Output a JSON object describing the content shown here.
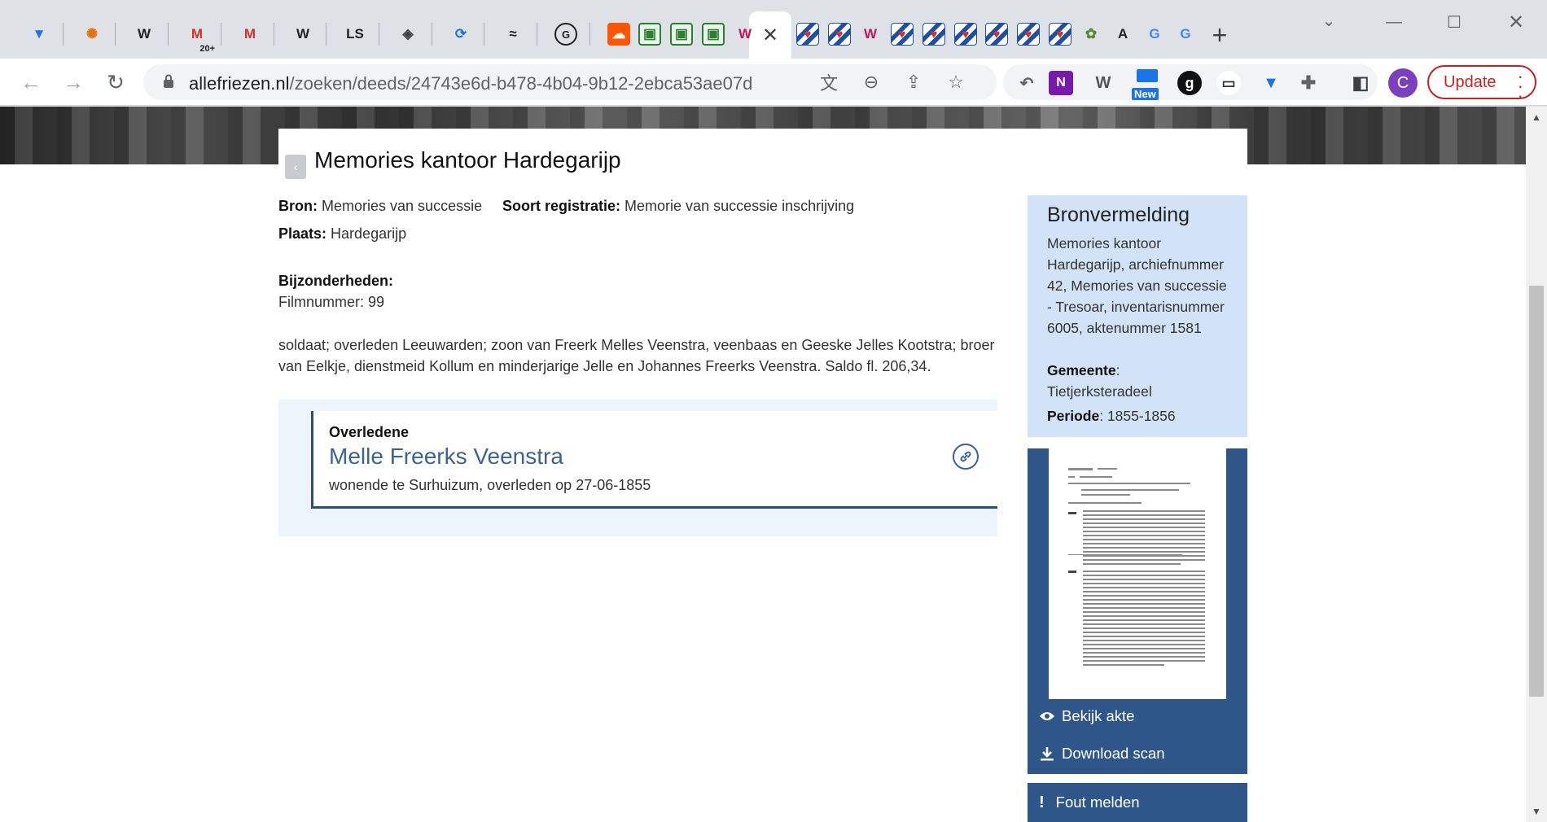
{
  "browser": {
    "active_tab_close": "✕",
    "new_tab": "+",
    "url_domain": "allefriezen.nl",
    "url_path": "/zoeken/deeds/24743e6d-b478-4b04-9b12-2ebca53ae07d",
    "avatar_letter": "C",
    "update_label": "Update",
    "tabs": [
      {
        "text": "",
        "color": "#1a73e8",
        "icon": "heart-shield-icon"
      },
      {
        "text": "✺",
        "color": "#e8710a",
        "icon": "leaf-icon"
      },
      {
        "text": "W",
        "color": "#202124",
        "icon": "wikipedia-icon"
      },
      {
        "text": "M",
        "color": "#d93025",
        "icon": "gmail-icon"
      },
      {
        "text": "M",
        "color": "#d93025",
        "icon": "gmail-icon"
      },
      {
        "text": "W",
        "color": "#202124",
        "icon": "wikipedia-icon"
      },
      {
        "text": "LS",
        "color": "#202124",
        "icon": "ls-icon"
      },
      {
        "text": "◈",
        "color": "#3c4043",
        "icon": "diamond-icon"
      },
      {
        "text": "⟳",
        "color": "#1a73e8",
        "icon": "sync-icon"
      },
      {
        "text": "≈",
        "color": "#202124",
        "icon": "wave-icon"
      },
      {
        "text": "G",
        "color": "#202124",
        "icon": "g-badge-icon"
      },
      {
        "text": "☁",
        "color": "#ff5500",
        "icon": "soundcloud-icon"
      },
      {
        "text": "▣",
        "color": "#2e7d32",
        "icon": "archive-icon"
      },
      {
        "text": "▣",
        "color": "#2e7d32",
        "icon": "archive-icon"
      },
      {
        "text": "▣",
        "color": "#2e7d32",
        "icon": "archive-icon"
      },
      {
        "text": "W",
        "color": "#c2185b",
        "icon": "w-red-icon"
      }
    ],
    "tabs_after": [
      {
        "text": "♥",
        "color": "#d32f2f",
        "icon": "frisian-flag-icon"
      },
      {
        "text": "♥",
        "color": "#d32f2f",
        "icon": "frisian-flag-icon"
      },
      {
        "text": "W",
        "color": "#c2185b",
        "icon": "w-red-icon"
      },
      {
        "text": "♥",
        "color": "#d32f2f",
        "icon": "frisian-flag-icon"
      },
      {
        "text": "♥",
        "color": "#d32f2f",
        "icon": "frisian-flag-icon"
      },
      {
        "text": "♥",
        "color": "#d32f2f",
        "icon": "frisian-flag-icon"
      },
      {
        "text": "♥",
        "color": "#d32f2f",
        "icon": "frisian-flag-icon"
      },
      {
        "text": "♥",
        "color": "#d32f2f",
        "icon": "frisian-flag-icon"
      },
      {
        "text": "♥",
        "color": "#d32f2f",
        "icon": "frisian-flag-icon"
      },
      {
        "text": "✿",
        "color": "#558b2f",
        "icon": "tree-icon"
      },
      {
        "text": "A",
        "color": "#202124",
        "icon": "a-icon"
      },
      {
        "text": "G",
        "color": "#4285f4",
        "icon": "google-icon"
      },
      {
        "text": "G",
        "color": "#4285f4",
        "icon": "google-icon"
      }
    ],
    "gmail_badge": "20+",
    "ext_new_label": "New",
    "ext_g_label": "g"
  },
  "page": {
    "title": "Memories kantoor Hardegarijp",
    "bron_label": "Bron:",
    "bron_value": "Memories van successie",
    "soort_label": "Soort registratie:",
    "soort_value": "Memorie van successie inschrijving",
    "plaats_label": "Plaats:",
    "plaats_value": "Hardegarijp",
    "bijzonderheden_label": "Bijzonderheden:",
    "filmnummer": "Filmnummer: 99",
    "description": "soldaat; overleden Leeuwarden; zoon van Freerk Melles Veenstra, veenbaas en Geeske Jelles Kootstra; broer van Eelkje, dienstmeid Kollum en minderjarige Jelle en Johannes Freerks Veenstra. Saldo fl. 206,34.",
    "person": {
      "role": "Overledene",
      "name": "Melle Freerks Veenstra",
      "details": "wonende te Surhuizum, overleden op 27-06-1855"
    },
    "source": {
      "title": "Bronvermelding",
      "text": "Memories kantoor Hardegarijp, archiefnummer 42, Memories van successie - Tresoar, inventarisnummer 6005, aktenummer 1581",
      "gemeente_label": "Gemeente",
      "gemeente_value": "Tietjerksteradeel",
      "periode_label": "Periode",
      "periode_value": "1855-1856"
    },
    "actions": {
      "view": "Bekijk akte",
      "download": "Download scan",
      "report": "Fout melden",
      "report_icon_text": "!"
    }
  },
  "colors": {
    "accent_blue": "#2f5688",
    "light_blue": "#d2e3f8",
    "link_blue": "#3b6395",
    "update_red": "#c5221f"
  }
}
